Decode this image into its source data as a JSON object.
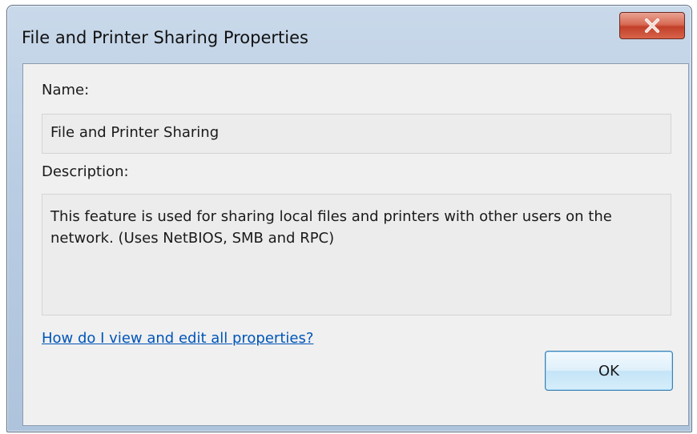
{
  "window": {
    "title": "File and Printer Sharing Properties",
    "close_icon": "close-x-icon",
    "accent_color": "#c2402a"
  },
  "form": {
    "name_label": "Name:",
    "name_value": "File and Printer Sharing",
    "description_label": "Description:",
    "description_value": "This feature is used for sharing local files and printers with other users on the network. (Uses NetBIOS, SMB and RPC)"
  },
  "help_link": "How do I view and edit all properties?",
  "buttons": {
    "ok": "OK"
  }
}
